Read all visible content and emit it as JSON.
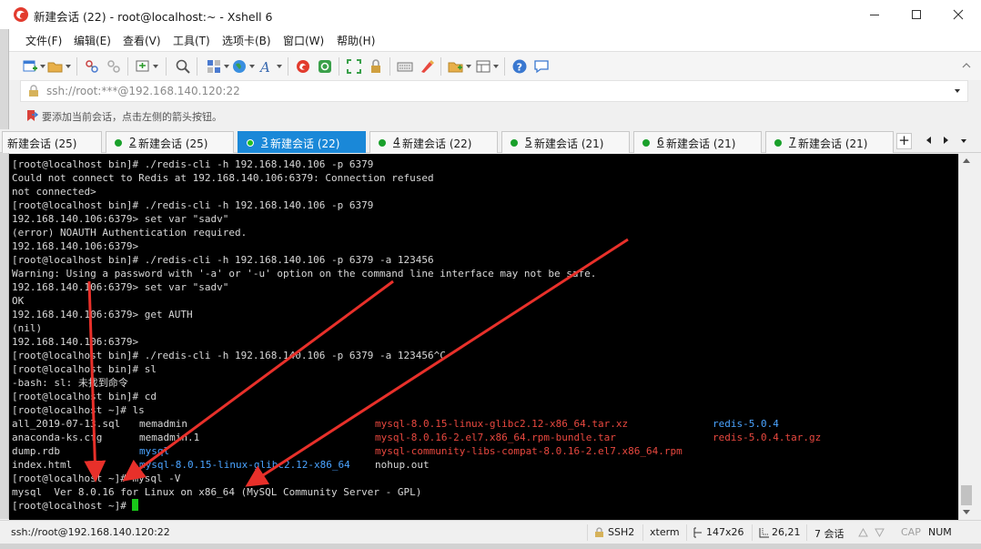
{
  "window": {
    "title": "新建会话 (22) - root@localhost:~ - Xshell 6"
  },
  "menu": {
    "items": [
      "文件(F)",
      "编辑(E)",
      "查看(V)",
      "工具(T)",
      "选项卡(B)",
      "窗口(W)",
      "帮助(H)"
    ]
  },
  "toolbar": {
    "icons": [
      "new-session-icon",
      "open-folder-icon",
      "connect-icon",
      "disconnect-icon",
      "new-window-icon",
      "search-icon",
      "transfer-icon",
      "globe-icon",
      "font-icon",
      "xshell-icon",
      "xftp-icon",
      "fullscreen-icon",
      "lock-icon",
      "keyboard-icon",
      "highlight-icon",
      "add-tab-icon",
      "layout-icon",
      "help-icon",
      "chat-icon"
    ]
  },
  "address": {
    "value": "ssh://root:***@192.168.140.120:22"
  },
  "hint": {
    "text": "要添加当前会话，点击左侧的箭头按钮。"
  },
  "tabs": [
    {
      "num": "",
      "label": "新建会话 (25)",
      "active": false
    },
    {
      "num": "2",
      "label": "新建会话 (25)",
      "active": false
    },
    {
      "num": "3",
      "label": "新建会话 (22)",
      "active": true
    },
    {
      "num": "4",
      "label": "新建会话 (22)",
      "active": false
    },
    {
      "num": "5",
      "label": "新建会话 (21)",
      "active": false
    },
    {
      "num": "6",
      "label": "新建会话 (21)",
      "active": false
    },
    {
      "num": "7",
      "label": "新建会话 (21)",
      "active": false
    }
  ],
  "terminal": {
    "lines": [
      "[root@localhost bin]# ./redis-cli -h 192.168.140.106 -p 6379",
      "Could not connect to Redis at 192.168.140.106:6379: Connection refused",
      "not connected>",
      "[root@localhost bin]# ./redis-cli -h 192.168.140.106 -p 6379",
      "192.168.140.106:6379> set var \"sadv\"",
      "(error) NOAUTH Authentication required.",
      "192.168.140.106:6379>",
      "[root@localhost bin]# ./redis-cli -h 192.168.140.106 -p 6379 -a 123456",
      "Warning: Using a password with '-a' or '-u' option on the command line interface may not be safe.",
      "192.168.140.106:6379> set var \"sadv\"",
      "OK",
      "192.168.140.106:6379> get AUTH",
      "(nil)",
      "192.168.140.106:6379>",
      "[root@localhost bin]# ./redis-cli -h 192.168.140.106 -p 6379 -a 123456^C",
      "[root@localhost bin]# sl",
      "-bash: sl: 未找到命令",
      "[root@localhost bin]# cd",
      "[root@localhost ~]# ls"
    ],
    "ls_rows": [
      {
        "c1": "all_2019-07-13.sql",
        "c2": "memadmin",
        "c3": "mysql-8.0.15-linux-glibc2.12-x86_64.tar.xz",
        "c4": "redis-5.0.4"
      },
      {
        "c1": "anaconda-ks.cfg",
        "c2": "memadmin.1",
        "c3": "mysql-8.0.16-2.el7.x86_64.rpm-bundle.tar",
        "c4": "redis-5.0.4.tar.gz"
      },
      {
        "c1": "dump.rdb",
        "c2": "mysql",
        "c3": "mysql-community-libs-compat-8.0.16-2.el7.x86_64.rpm",
        "c4": ""
      },
      {
        "c1": "index.html",
        "c2": "mysql-8.0.15-linux-glibc2.12-x86_64",
        "c3": "nohup.out",
        "c4": ""
      }
    ],
    "after_lines": [
      "[root@localhost ~]# mysql -V",
      "mysql  Ver 8.0.16 for Linux on x86_64 (MySQL Community Server - GPL)"
    ],
    "prompt": "[root@localhost ~]# ",
    "colors": {
      "background": "#000000",
      "text": "#d8d8d8",
      "red": "#e8483f",
      "blue": "#4aa3ff",
      "arrow": "#e8302a",
      "cursor": "#19c719"
    }
  },
  "status": {
    "connection": "ssh://root@192.168.140.120:22",
    "protocol": "SSH2",
    "terminal_type": "xterm",
    "size": "147x26",
    "position": "26,21",
    "sessions": "7 会话",
    "cap": "CAP",
    "num": "NUM"
  },
  "accent": "#1a88d8"
}
